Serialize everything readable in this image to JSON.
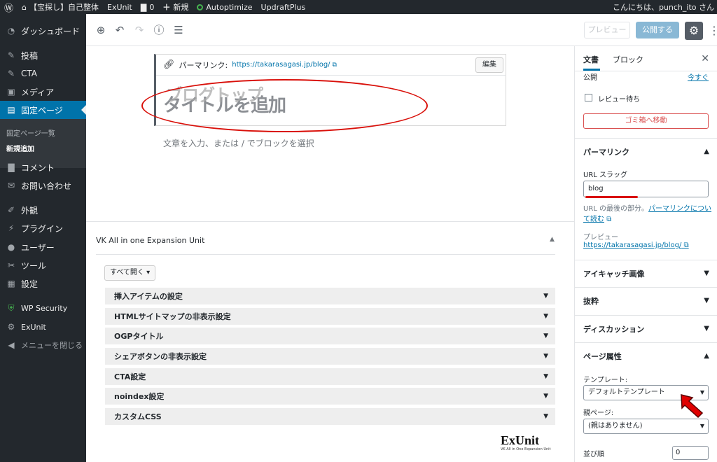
{
  "adminbar": {
    "site_name": "【宝探し】自己整体",
    "exunit": "ExUnit",
    "comments_count": "0",
    "new_label": "新規",
    "autoptimize": "Autoptimize",
    "updraft": "UpdraftPlus",
    "greeting": "こんにちは、punch_ito さん"
  },
  "sidebar": {
    "items": [
      {
        "label": "ダッシュボード",
        "icon": "dashboard-icon"
      },
      {
        "label": "投稿",
        "icon": "pin-icon"
      },
      {
        "label": "CTA",
        "icon": "pin-icon"
      },
      {
        "label": "メディア",
        "icon": "media-icon"
      },
      {
        "label": "固定ページ",
        "icon": "page-icon"
      },
      {
        "label": "コメント",
        "icon": "comment-icon"
      },
      {
        "label": "お問い合わせ",
        "icon": "mail-icon"
      },
      {
        "label": "外観",
        "icon": "brush-icon"
      },
      {
        "label": "プラグイン",
        "icon": "plugin-icon"
      },
      {
        "label": "ユーザー",
        "icon": "user-icon"
      },
      {
        "label": "ツール",
        "icon": "wrench-icon"
      },
      {
        "label": "設定",
        "icon": "settings-icon"
      },
      {
        "label": "WP Security",
        "icon": "shield-icon"
      },
      {
        "label": "ExUnit",
        "icon": "gear-icon"
      },
      {
        "label": "メニューを閉じる",
        "icon": "collapse-icon"
      }
    ],
    "submenu": {
      "all_pages": "固定ページ一覧",
      "add_new": "新規追加"
    }
  },
  "toolbar": {
    "preview": "プレビュー",
    "publish": "公開する"
  },
  "editor": {
    "permalink_label": "パーマリンク:",
    "permalink_url": "https://takarasagasi.jp/blog/",
    "edit_button": "編集",
    "title_placeholder": "タイトルを追加",
    "title_overlay": "ブログトップ",
    "block_placeholder": "文章を入力、または / でブロックを選択"
  },
  "metabox": {
    "title": "VK All in one Expansion Unit",
    "open_all": "すべて開く ▾",
    "rows": [
      "挿入アイテムの設定",
      "HTMLサイトマップの非表示設定",
      "OGPタイトル",
      "シェアボタンの非表示設定",
      "CTA設定",
      "noindex設定",
      "カスタムCSS"
    ],
    "logo": "ExUnit",
    "logo_sub": "VK All in One Expansion Unit"
  },
  "settings": {
    "tab_document": "文書",
    "tab_block": "ブロック",
    "publish_cut": "公開",
    "publish_link_cut": "今すぐ",
    "pending_review": "レビュー待ち",
    "trash": "ゴミ箱へ移動",
    "permalink_panel": "パーマリンク",
    "url_slug_label": "URL スラッグ",
    "url_slug_value": "blog",
    "help_prefix": "URL の最後の部分。",
    "help_link": "パーマリンクについて読む",
    "preview_label": "プレビュー",
    "preview_url": "https://takarasagasi.jp/blog/",
    "featured_image": "アイキャッチ画像",
    "excerpt": "抜粋",
    "discussion": "ディスカッション",
    "page_attributes": "ページ属性",
    "template_label": "テンプレート:",
    "template_value": "デフォルトテンプレート",
    "parent_label": "親ページ:",
    "parent_value": "(親はありません)",
    "order_label": "並び順",
    "order_value": "0"
  },
  "colors": {
    "admin_dark": "#23282d",
    "accent": "#0073aa",
    "annotation_red": "#d9100a"
  }
}
